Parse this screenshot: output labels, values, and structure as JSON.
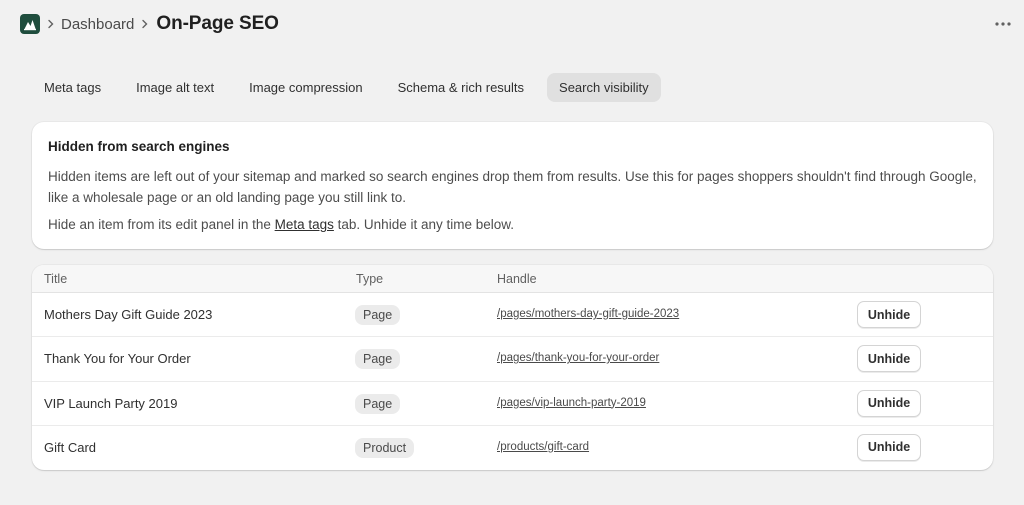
{
  "header": {
    "breadcrumb": "Dashboard",
    "page_title": "On-Page SEO",
    "app_icon": "app-logo-icon",
    "more_icon": "more-horizontal-icon"
  },
  "tabs": [
    {
      "label": "Meta tags",
      "active": false
    },
    {
      "label": "Image alt text",
      "active": false
    },
    {
      "label": "Image compression",
      "active": false
    },
    {
      "label": "Schema & rich results",
      "active": false
    },
    {
      "label": "Search visibility",
      "active": true
    }
  ],
  "info": {
    "title": "Hidden from search engines",
    "paragraph": "Hidden items are left out of your sitemap and marked so search engines drop them from results. Use this for pages shoppers shouldn't find through Google, like a wholesale page or an old landing page you still link to.",
    "line2_before": "Hide an item from its edit panel in the ",
    "line2_link": "Meta tags",
    "line2_after": " tab. Unhide it any time below."
  },
  "table": {
    "columns": {
      "title": "Title",
      "type": "Type",
      "handle": "Handle"
    },
    "rows": [
      {
        "title": "Mothers Day Gift Guide 2023",
        "type": "Page",
        "handle": "/pages/mothers-day-gift-guide-2023",
        "action": "Unhide"
      },
      {
        "title": "Thank You for Your Order",
        "type": "Page",
        "handle": "/pages/thank-you-for-your-order",
        "action": "Unhide"
      },
      {
        "title": "VIP Launch Party 2019",
        "type": "Page",
        "handle": "/pages/vip-launch-party-2019",
        "action": "Unhide"
      },
      {
        "title": "Gift Card",
        "type": "Product",
        "handle": "/products/gift-card",
        "action": "Unhide"
      }
    ]
  },
  "colors": {
    "background": "#f1f1f1",
    "card": "#ffffff",
    "active_tab": "#e0e0e0",
    "app_icon": "#1f4d3d"
  }
}
